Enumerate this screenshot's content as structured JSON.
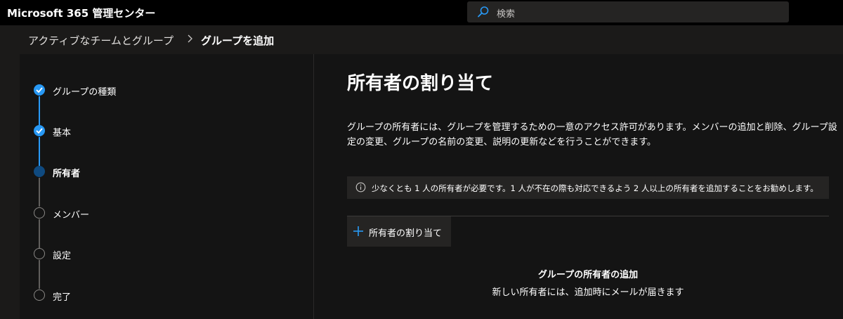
{
  "header": {
    "app_title": "Microsoft 365 管理センター",
    "search_placeholder": "検索"
  },
  "breadcrumb": {
    "parent": "アクティブなチームとグループ",
    "current": "グループを追加"
  },
  "wizard": {
    "steps": [
      {
        "label": "グループの種類",
        "status": "done"
      },
      {
        "label": "基本",
        "status": "done"
      },
      {
        "label": "所有者",
        "status": "current"
      },
      {
        "label": "メンバー",
        "status": "pending"
      },
      {
        "label": "設定",
        "status": "pending"
      },
      {
        "label": "完了",
        "status": "pending"
      }
    ]
  },
  "main": {
    "heading": "所有者の割り当て",
    "description": "グループの所有者には、グループを管理するための一意のアクセス許可があります。メンバーの追加と削除、グループ設定の変更、グループの名前の変更、説明の更新などを行うことができます。",
    "info": "少なくとも 1 人の所有者が必要です。1 人が不在の際も対応できるよう 2 人以上の所有者を追加することをお勧めします。",
    "assign_button": "所有者の割り当て",
    "empty_title": "グループの所有者の追加",
    "empty_subtitle": "新しい所有者には、追加時にメールが届きます"
  },
  "colors": {
    "accent": "#2899f5",
    "current_step": "#0f4a80",
    "background": "#1b1a19",
    "panel": "#141414",
    "topbar": "#000000"
  },
  "icons": [
    "search-icon",
    "chevron-right-icon",
    "check-icon",
    "info-icon",
    "plus-icon"
  ]
}
